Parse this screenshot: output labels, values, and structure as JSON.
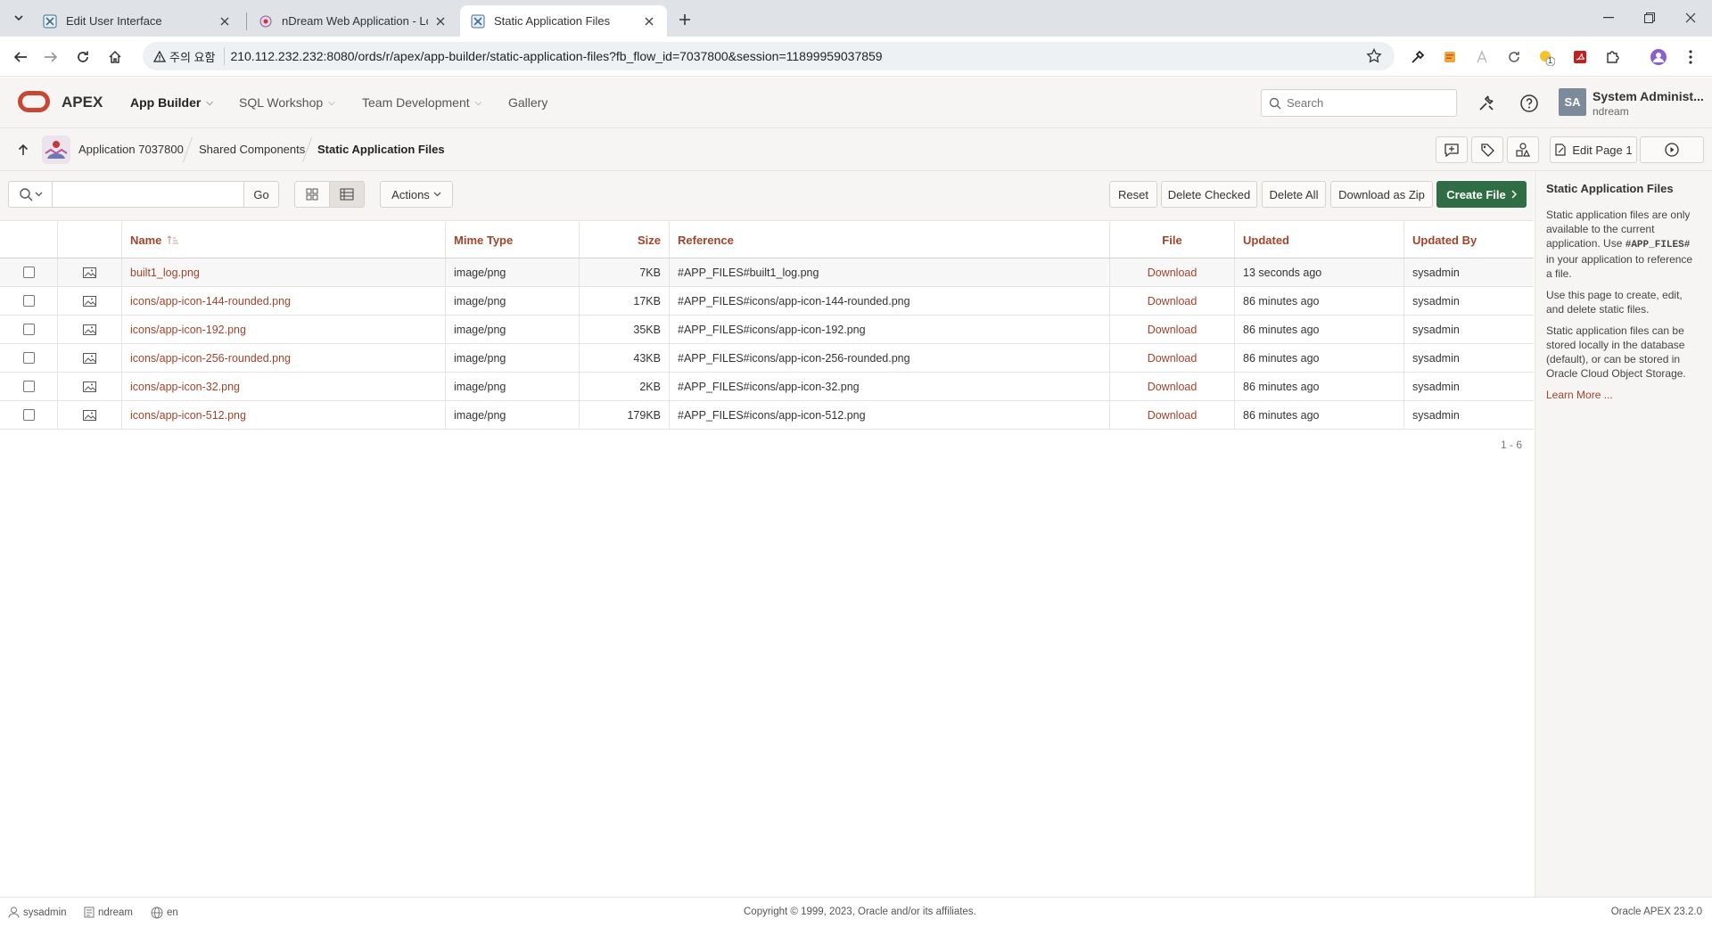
{
  "browser": {
    "tabs": [
      {
        "title": "Edit User Interface",
        "active": false
      },
      {
        "title": "nDream Web Application - Lo",
        "active": false
      },
      {
        "title": "Static Application Files",
        "active": true
      }
    ],
    "address": {
      "warning": "주의 요함",
      "url": "210.112.232.232:8080/ords/r/apex/app-builder/static-application-files?fb_flow_id=7037800&session=11899959037859"
    },
    "extension_badge": "1"
  },
  "header": {
    "brand": "APEX",
    "nav": [
      {
        "label": "App Builder",
        "active": true,
        "dropdown": true
      },
      {
        "label": "SQL Workshop",
        "active": false,
        "dropdown": true
      },
      {
        "label": "Team Development",
        "active": false,
        "dropdown": true
      },
      {
        "label": "Gallery",
        "active": false,
        "dropdown": false
      }
    ],
    "search_placeholder": "Search",
    "user": {
      "initials": "SA",
      "name": "System Administ...",
      "workspace": "ndream"
    }
  },
  "breadcrumb": {
    "items": [
      "Application 7037800",
      "Shared Components",
      "Static Application Files"
    ],
    "edit_page_label": "Edit Page 1"
  },
  "toolbar": {
    "go_label": "Go",
    "actions_label": "Actions",
    "reset_label": "Reset",
    "delete_checked_label": "Delete Checked",
    "delete_all_label": "Delete All",
    "download_zip_label": "Download as Zip",
    "create_label": "Create File"
  },
  "table": {
    "columns": {
      "name": "Name",
      "mime": "Mime Type",
      "size": "Size",
      "reference": "Reference",
      "file": "File",
      "updated": "Updated",
      "updated_by": "Updated By"
    },
    "rows": [
      {
        "name": "built1_log.png",
        "mime": "image/png",
        "size": "7KB",
        "reference": "#APP_FILES#built1_log.png",
        "file": "Download",
        "updated": "13 seconds ago",
        "updated_by": "sysadmin"
      },
      {
        "name": "icons/app-icon-144-rounded.png",
        "mime": "image/png",
        "size": "17KB",
        "reference": "#APP_FILES#icons/app-icon-144-rounded.png",
        "file": "Download",
        "updated": "86 minutes ago",
        "updated_by": "sysadmin"
      },
      {
        "name": "icons/app-icon-192.png",
        "mime": "image/png",
        "size": "35KB",
        "reference": "#APP_FILES#icons/app-icon-192.png",
        "file": "Download",
        "updated": "86 minutes ago",
        "updated_by": "sysadmin"
      },
      {
        "name": "icons/app-icon-256-rounded.png",
        "mime": "image/png",
        "size": "43KB",
        "reference": "#APP_FILES#icons/app-icon-256-rounded.png",
        "file": "Download",
        "updated": "86 minutes ago",
        "updated_by": "sysadmin"
      },
      {
        "name": "icons/app-icon-32.png",
        "mime": "image/png",
        "size": "2KB",
        "reference": "#APP_FILES#icons/app-icon-32.png",
        "file": "Download",
        "updated": "86 minutes ago",
        "updated_by": "sysadmin"
      },
      {
        "name": "icons/app-icon-512.png",
        "mime": "image/png",
        "size": "179KB",
        "reference": "#APP_FILES#icons/app-icon-512.png",
        "file": "Download",
        "updated": "86 minutes ago",
        "updated_by": "sysadmin"
      }
    ],
    "pagination": "1 - 6"
  },
  "help": {
    "title": "Static Application Files",
    "p1_before": "Static application files are only available to the current application. Use ",
    "p1_code": "#APP_FILES#",
    "p1_after": " in your application to reference a file.",
    "p2": "Use this page to create, edit, and delete static files.",
    "p3": "Static application files can be stored locally in the database (default), or can be stored in Oracle Cloud Object Storage.",
    "learn_more": "Learn More ..."
  },
  "footer": {
    "user": "sysadmin",
    "workspace": "ndream",
    "language": "en",
    "copyright": "Copyright © 1999, 2023, Oracle and/or its affiliates.",
    "version": "Oracle APEX 23.2.0"
  },
  "colors": {
    "accent": "#a0442a",
    "brand": "#c74634",
    "primary_button": "#2f6e45"
  }
}
